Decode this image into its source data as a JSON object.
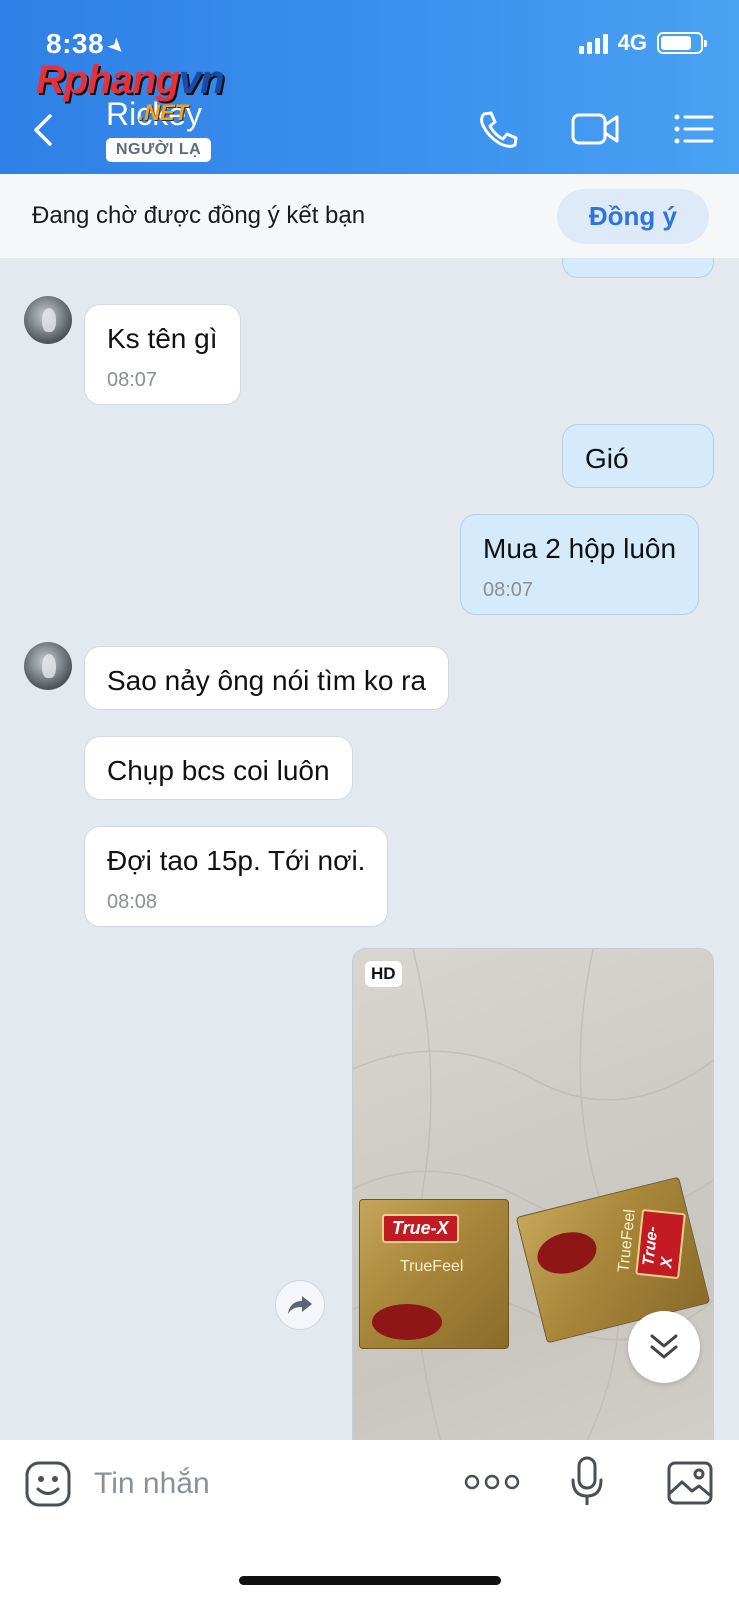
{
  "status_bar": {
    "time": "8:38",
    "network": "4G"
  },
  "watermark": {
    "main_a": "Rphang",
    "main_b": "vn",
    "suffix": ".NET"
  },
  "header": {
    "contact_name": "Rickey",
    "badge": "NGƯỜI LẠ"
  },
  "pending": {
    "text": "Đang chờ được đồng ý kết bạn",
    "accept_label": "Đồng ý"
  },
  "messages": [
    {
      "dir": "in",
      "text": "Ks tên gì",
      "time": "08:07"
    },
    {
      "dir": "out",
      "text": "Gió"
    },
    {
      "dir": "out",
      "text": "Mua 2 hộp luôn",
      "time": "08:07"
    },
    {
      "dir": "in",
      "text": "Sao nảy ông nói tìm ko ra"
    },
    {
      "dir": "in",
      "text": "Chụp bcs coi luôn"
    },
    {
      "dir": "in",
      "text": "Đợi tao 15p. Tới nơi.",
      "time": "08:08"
    }
  ],
  "photo": {
    "badge": "HD",
    "box1": {
      "brand": "True-X",
      "sub": "TrueFeel"
    },
    "box2": {
      "brand": "True-X",
      "sub": "TrueFeel"
    }
  },
  "composer": {
    "placeholder": "Tin nhắn"
  },
  "colors": {
    "header": "#3c92ee",
    "accent": "#2e75d9",
    "out_bubble": "#d5ebfb"
  }
}
